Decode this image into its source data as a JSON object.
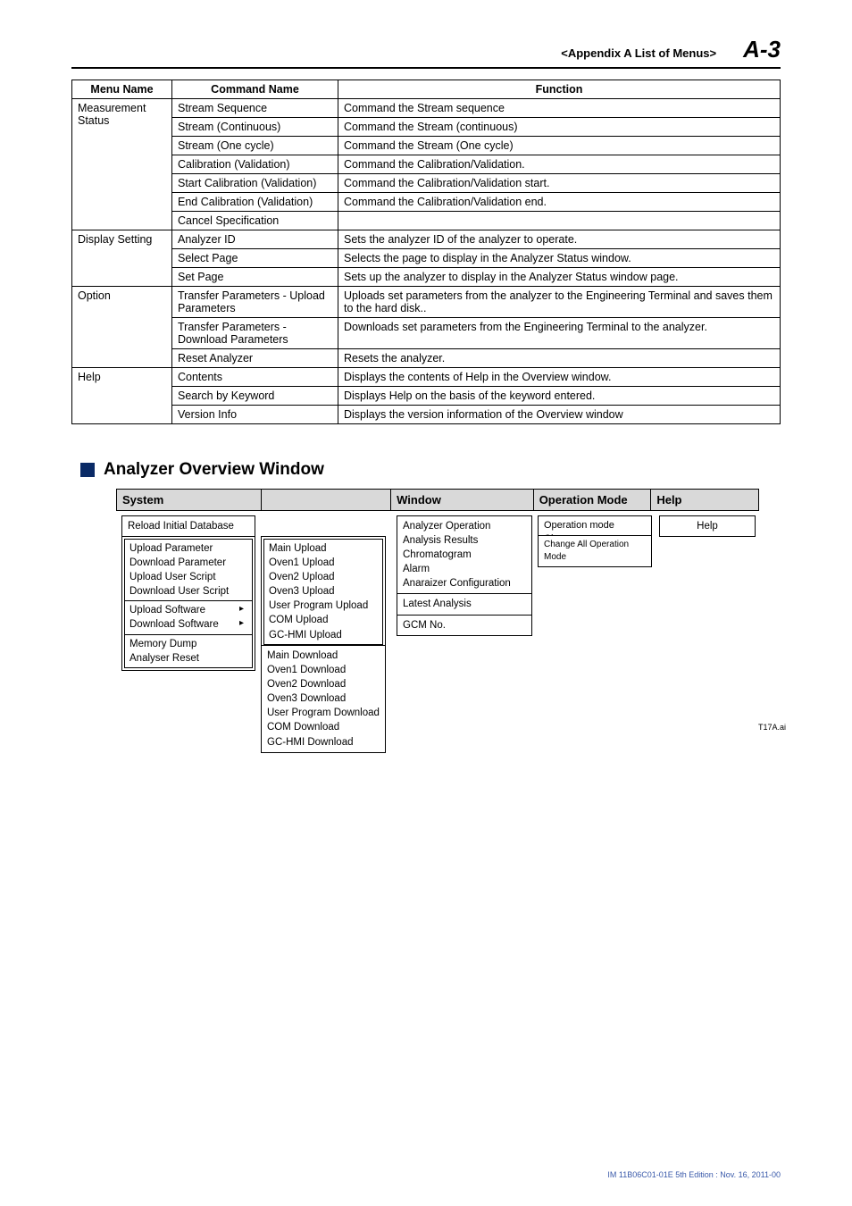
{
  "header": {
    "subtitle": "<Appendix A  List of Menus>",
    "pagenum": "A-3"
  },
  "table": {
    "headers": {
      "menu": "Menu Name",
      "command": "Command Name",
      "function": "Function"
    },
    "groups": [
      {
        "menu": "Measurement Status",
        "rows": [
          {
            "cmd": "Stream Sequence",
            "fn": "Command the Stream sequence"
          },
          {
            "cmd": "Stream (Continuous)",
            "fn": "Command the Stream (continuous)"
          },
          {
            "cmd": "Stream (One cycle)",
            "fn": "Command the Stream (One cycle)"
          },
          {
            "cmd": "Calibration (Validation)",
            "fn": "Command the Calibration/Validation."
          },
          {
            "cmd": "Start Calibration (Validation)",
            "fn": "Command the Calibration/Validation start."
          },
          {
            "cmd": "End Calibration (Validation)",
            "fn": "Command the Calibration/Validation end."
          },
          {
            "cmd": "Cancel Specification",
            "fn": ""
          }
        ]
      },
      {
        "menu": "Display Setting",
        "rows": [
          {
            "cmd": "Analyzer ID",
            "fn": "Sets the analyzer ID of the analyzer to operate."
          },
          {
            "cmd": "Select Page",
            "fn": "Selects the page to display in the Analyzer Status window."
          },
          {
            "cmd": "Set Page",
            "fn": "Sets up the analyzer to display in the Analyzer Status window page."
          }
        ]
      },
      {
        "menu": "Option",
        "rows": [
          {
            "cmd": "Transfer Parameters - Upload Parameters",
            "fn": "Uploads set parameters from the analyzer to the Engineering Terminal and saves them to the hard disk.."
          },
          {
            "cmd": "Transfer Parameters - Download Parameters",
            "fn": "Downloads set parameters from the Engineering Terminal to the analyzer."
          },
          {
            "cmd": "Reset Analyzer",
            "fn": "Resets the analyzer."
          }
        ]
      },
      {
        "menu": "Help",
        "rows": [
          {
            "cmd": "Contents",
            "fn": "Displays the contents of Help in the Overview window."
          },
          {
            "cmd": "Search by Keyword",
            "fn": "Displays Help on the basis of the keyword entered."
          },
          {
            "cmd": "Version Info",
            "fn": "Displays the version information of the Overview window"
          }
        ]
      }
    ]
  },
  "section": {
    "title": "Analyzer Overview Window"
  },
  "overview": {
    "headers": {
      "system": "System",
      "window": "Window",
      "opmode": "Operation Mode",
      "help": "Help"
    },
    "system_box1": [
      "Reload Initial Database"
    ],
    "system_box2_a": [
      "Upload Parameter",
      "Download Parameter",
      "Upload User Script",
      "Download User Script"
    ],
    "system_box2_b": [
      "Upload Software",
      "Download Software"
    ],
    "system_box2_c": [
      "Memory Dump",
      "Analyser Reset"
    ],
    "upload_sub": [
      "Main Upload",
      "Oven1 Upload",
      "Oven2 Upload",
      "Oven3 Upload",
      "User Program Upload",
      "COM Upload",
      "GC-HMI Upload"
    ],
    "download_sub": [
      "Main Download",
      "Oven1 Download",
      "Oven2 Download",
      "Oven3 Download",
      "User Program Download",
      "COM Download",
      "GC-HMI Download"
    ],
    "window_box_a": [
      "Analyzer Operation",
      "Analysis Results",
      "Chromatogram",
      "Alarm",
      "Anaraizer Configuration"
    ],
    "window_box_b": [
      "Latest Analysis"
    ],
    "window_box_c": [
      "GCM No."
    ],
    "opmode_box": [
      "Operation mode Change"
    ],
    "opmode_box2": [
      "Change All Operation Mode"
    ],
    "help_box": [
      "Help"
    ]
  },
  "footnote": "T17A.ai",
  "footer": "IM 11B06C01-01E     5th Edition : Nov. 16, 2011-00"
}
